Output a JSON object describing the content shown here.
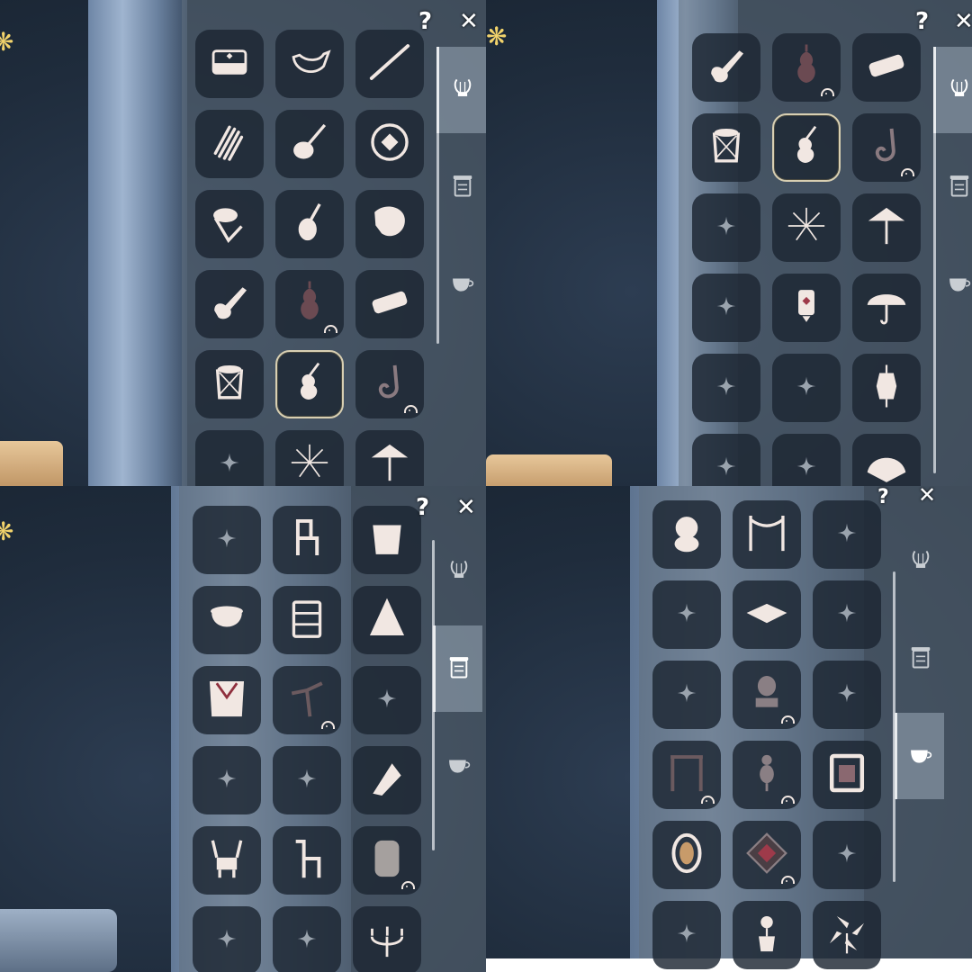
{
  "colors": {
    "icon": "#f1e7e2",
    "icon_dark": "#b19aa0",
    "slot_bg": "#1c2632",
    "tab_active": "#9baab8"
  },
  "top_buttons": {
    "help_label": "?",
    "close_label": "✕"
  },
  "tabs": [
    {
      "id": "instruments",
      "icon": "lyre-icon"
    },
    {
      "id": "furniture",
      "icon": "storage-box-icon"
    },
    {
      "id": "consumables",
      "icon": "teacup-icon"
    }
  ],
  "panels": [
    {
      "active_tab": "instruments",
      "items": [
        "piano",
        "ocarina",
        "flute",
        "panpipe",
        "ukulele",
        "handpan",
        "djembe",
        "pipa",
        "conch-shell",
        "electric-guitar",
        "cello",
        "harmonica",
        "drum",
        "violin",
        "saxophone",
        "locked",
        "firework-staff",
        "parasol"
      ],
      "owned": [
        true,
        true,
        true,
        true,
        true,
        true,
        true,
        true,
        true,
        true,
        false,
        true,
        true,
        true,
        false,
        false,
        true,
        true
      ],
      "selected": 13
    },
    {
      "active_tab": "instruments",
      "items": [
        "electric-guitar",
        "cello",
        "harmonica",
        "drum",
        "violin",
        "saxophone",
        "locked",
        "firework-staff",
        "parasol",
        "locked",
        "tea-lantern",
        "umbrella",
        "locked",
        "locked",
        "hanging-lantern",
        "locked",
        "locked",
        "hand-fan"
      ],
      "owned": [
        true,
        false,
        true,
        true,
        true,
        false,
        false,
        true,
        true,
        false,
        true,
        true,
        false,
        false,
        true,
        false,
        false,
        true
      ],
      "selected": 4
    },
    {
      "active_tab": "furniture",
      "items": [
        "locked",
        "chair",
        "bucket",
        "cauldron",
        "wardrobe",
        "tent",
        "banner",
        "branch",
        "locked",
        "locked",
        "locked",
        "deck-chair",
        "antler-chair",
        "llama-chair",
        "stone-stove",
        "locked",
        "locked",
        "candelabra"
      ],
      "owned": [
        false,
        true,
        true,
        true,
        true,
        true,
        true,
        false,
        false,
        false,
        false,
        true,
        true,
        true,
        false,
        false,
        false,
        true
      ],
      "selected": -1
    },
    {
      "active_tab": "consumables",
      "items": [
        "moomin-plush",
        "bunting",
        "locked",
        "locked",
        "cushion",
        "locked",
        "locked",
        "music-box",
        "locked",
        "checkered-stand",
        "mannequin",
        "picture-frame",
        "oval-mirror",
        "diamond-rug",
        "locked",
        "locked",
        "rose-pot",
        "pinwheel"
      ],
      "owned": [
        true,
        true,
        false,
        false,
        true,
        false,
        false,
        false,
        false,
        false,
        false,
        true,
        true,
        false,
        false,
        false,
        true,
        true
      ],
      "selected": -1
    }
  ]
}
